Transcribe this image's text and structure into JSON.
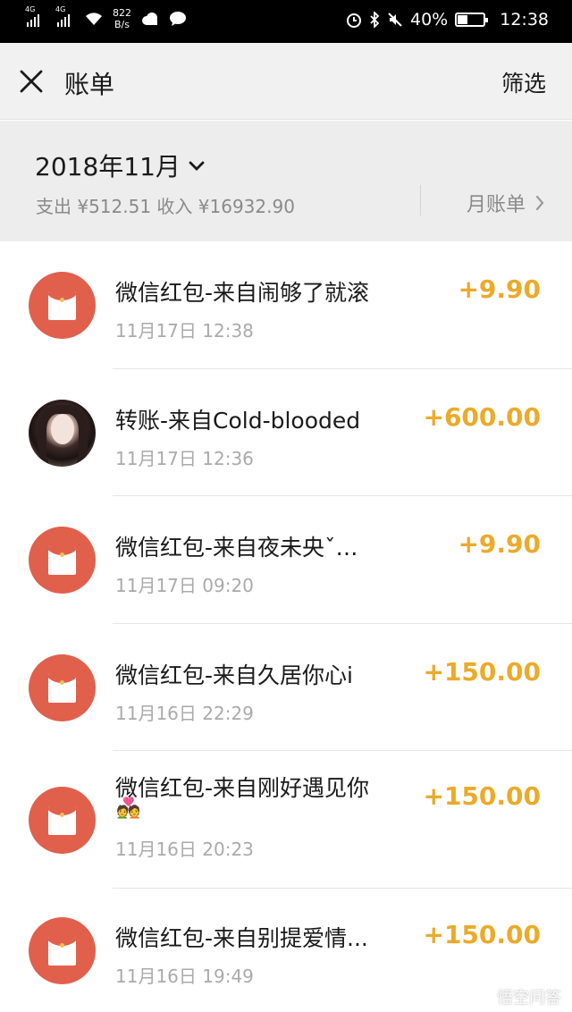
{
  "status_bar": {
    "network_1": "4G",
    "network_2": "4G",
    "speed_value": "822",
    "speed_unit": "B/s",
    "battery_text": "40%",
    "battery_level": 0.4,
    "time": "12:38"
  },
  "nav": {
    "title": "账单",
    "filter_label": "筛选"
  },
  "summary": {
    "month": "2018年11月",
    "totals": "支出 ¥512.51 收入 ¥16932.90",
    "monthly_bill_label": "月账单"
  },
  "transactions": [
    {
      "type": "red-packet",
      "name": "微信红包-来自闹够了就滚",
      "date": "11月17日 12:38",
      "amount": "+9.90"
    },
    {
      "type": "transfer",
      "name": "转账-来自Cold-blooded",
      "date": "11月17日 12:36",
      "amount": "+600.00"
    },
    {
      "type": "red-packet",
      "name": "微信红包-来自夜未央ˇ…",
      "date": "11月17日 09:20",
      "amount": "+9.90"
    },
    {
      "type": "red-packet",
      "name": "微信红包-来自久居你心i",
      "date": "11月16日 22:29",
      "amount": "+150.00"
    },
    {
      "type": "red-packet",
      "name": "微信红包-来自刚好遇见你",
      "name_suffix": "💑",
      "date": "11月16日 20:23",
      "amount": "+150.00"
    },
    {
      "type": "red-packet",
      "name": "微信红包-来自别提爱情...",
      "date": "11月16日 19:49",
      "amount": "+150.00"
    }
  ],
  "watermark": "悟空问答",
  "colors": {
    "amount": "#ecaa2a",
    "red_packet": "#e0604c",
    "summary_bg": "#ededed"
  }
}
